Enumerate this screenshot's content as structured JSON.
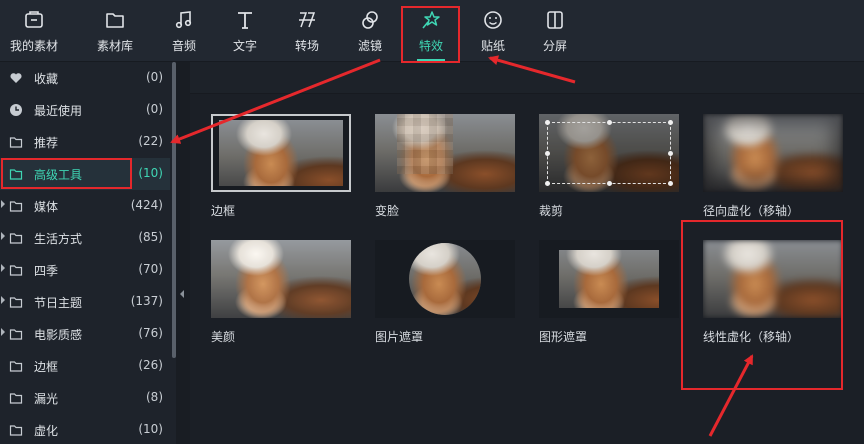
{
  "toolbar": {
    "tools": [
      {
        "label": "我的素材",
        "icon": "folder-media-icon"
      },
      {
        "label": "素材库",
        "icon": "folder-icon"
      },
      {
        "label": "音频",
        "icon": "music-note-icon"
      },
      {
        "label": "文字",
        "icon": "text-icon"
      },
      {
        "label": "转场",
        "icon": "transition-icon"
      },
      {
        "label": "滤镜",
        "icon": "filter-icon"
      },
      {
        "label": "特效",
        "icon": "magic-wand-icon",
        "active": true
      },
      {
        "label": "贴纸",
        "icon": "sticker-icon"
      },
      {
        "label": "分屏",
        "icon": "split-screen-icon"
      }
    ]
  },
  "sidebar": {
    "items": [
      {
        "label": "收藏",
        "count": "(0)",
        "icon": "heart-icon"
      },
      {
        "label": "最近使用",
        "count": "(0)",
        "icon": "clock-icon"
      },
      {
        "label": "推荐",
        "count": "(22)",
        "icon": "folder-icon"
      },
      {
        "label": "高级工具",
        "count": "(10)",
        "icon": "folder-icon",
        "active": true
      },
      {
        "label": "媒体",
        "count": "(424)",
        "icon": "folder-icon",
        "expandable": true
      },
      {
        "label": "生活方式",
        "count": "(85)",
        "icon": "folder-icon",
        "expandable": true
      },
      {
        "label": "四季",
        "count": "(70)",
        "icon": "folder-icon",
        "expandable": true
      },
      {
        "label": "节日主题",
        "count": "(137)",
        "icon": "folder-icon",
        "expandable": true
      },
      {
        "label": "电影质感",
        "count": "(76)",
        "icon": "folder-icon",
        "expandable": true
      },
      {
        "label": "边框",
        "count": "(26)",
        "icon": "folder-icon"
      },
      {
        "label": "漏光",
        "count": "(8)",
        "icon": "folder-icon"
      },
      {
        "label": "虚化",
        "count": "(10)",
        "icon": "folder-icon"
      }
    ]
  },
  "effects": [
    {
      "label": "边框",
      "style": "border",
      "selected": true
    },
    {
      "label": "变脸",
      "style": "mosaic"
    },
    {
      "label": "裁剪",
      "style": "crop"
    },
    {
      "label": "径向虚化（移轴）",
      "style": "radial-blur"
    },
    {
      "label": "美颜",
      "style": "beauty"
    },
    {
      "label": "图片遮罩",
      "style": "circle-mask"
    },
    {
      "label": "图形遮罩",
      "style": "shape-mask"
    },
    {
      "label": "线性虚化（移轴）",
      "style": "linear-blur"
    }
  ],
  "colors": {
    "accent": "#3fd6b4",
    "annotation": "#e5282c",
    "background": "#1b1f26",
    "panel": "#222831"
  }
}
